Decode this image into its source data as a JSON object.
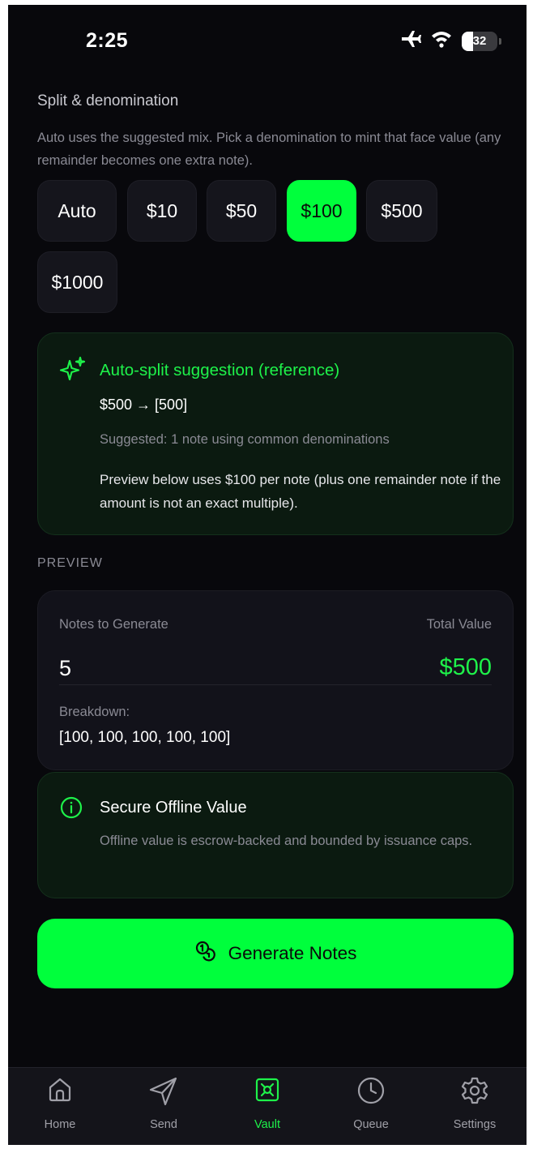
{
  "status_bar": {
    "time": "2:25",
    "battery": "32"
  },
  "split": {
    "title": "Split & denomination",
    "description": "Auto uses the suggested mix. Pick a denomination to mint that face value (any remainder becomes one extra note).",
    "options": [
      {
        "label": "Auto",
        "active": false
      },
      {
        "label": "$10",
        "active": false
      },
      {
        "label": "$50",
        "active": false
      },
      {
        "label": "$100",
        "active": true
      },
      {
        "label": "$500",
        "active": false
      },
      {
        "label": "$1000",
        "active": false
      }
    ]
  },
  "suggestion": {
    "title": "Auto-split suggestion (reference)",
    "mapping": "$500 → [500]",
    "suggested": "Suggested: 1 note using common denominations",
    "preview_note": "Preview below uses $100 per note (plus one remainder note if the amount is not an exact multiple)."
  },
  "preview": {
    "label": "PREVIEW",
    "notes_label": "Notes to Generate",
    "notes_value": "5",
    "total_label": "Total Value",
    "total_value": "$500",
    "breakdown_label": "Breakdown:",
    "breakdown_value": "[100, 100, 100, 100, 100]"
  },
  "secure": {
    "title": "Secure Offline Value",
    "description": "Offline value is escrow-backed and bounded by issuance caps."
  },
  "generate_button": {
    "label": "Generate Notes"
  },
  "tabbar": {
    "items": [
      {
        "label": "Home",
        "icon": "home-icon",
        "active": false
      },
      {
        "label": "Send",
        "icon": "send-icon",
        "active": false
      },
      {
        "label": "Vault",
        "icon": "vault-icon",
        "active": true
      },
      {
        "label": "Queue",
        "icon": "clock-icon",
        "active": false
      },
      {
        "label": "Settings",
        "icon": "gear-icon",
        "active": false
      }
    ]
  },
  "colors": {
    "accent": "#00ff3c",
    "background": "#08080c",
    "card": "#12121a",
    "muted": "#8a8a94"
  }
}
